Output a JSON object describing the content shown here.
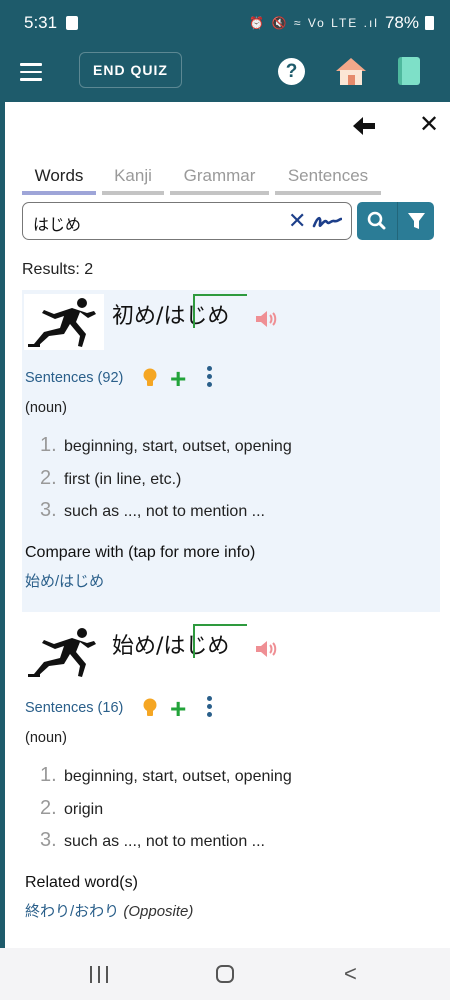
{
  "status": {
    "time": "5:31",
    "icons": "⏰ 🔇 ≈ Vo LTE .ıl",
    "battery": "78%"
  },
  "app_bar": {
    "end_quiz_label": "END QUIZ",
    "help_symbol": "?"
  },
  "header": {
    "close_symbol": "✕"
  },
  "tabs": [
    {
      "label": "Words",
      "active": true
    },
    {
      "label": "Kanji",
      "active": false
    },
    {
      "label": "Grammar",
      "active": false
    },
    {
      "label": "Sentences",
      "active": false
    }
  ],
  "search": {
    "value": "はじめ",
    "clear_symbol": "✕"
  },
  "results_label": "Results: 2",
  "entries": [
    {
      "word": "初め/はじめ",
      "sentences_link": "Sentences (92)",
      "part_of_speech": "(noun)",
      "definitions": [
        {
          "num": "1.",
          "text": "beginning, start, outset, opening"
        },
        {
          "num": "2.",
          "text": "first (in line, etc.)"
        },
        {
          "num": "3.",
          "text": "such as ..., not to mention ..."
        }
      ],
      "related_title": "Compare with (tap for more info)",
      "related_link": "始め/はじめ",
      "related_note": ""
    },
    {
      "word": "始め/はじめ",
      "sentences_link": "Sentences (16)",
      "part_of_speech": "(noun)",
      "definitions": [
        {
          "num": "1.",
          "text": "beginning, start, outset, opening"
        },
        {
          "num": "2.",
          "text": "origin"
        },
        {
          "num": "3.",
          "text": "such as ..., not to mention ..."
        }
      ],
      "related_title": "Related word(s)",
      "related_link": "終わり/おわり",
      "related_note": "(Opposite)"
    }
  ],
  "nav": {
    "back_symbol": "<"
  },
  "colors": {
    "app_bar": "#1e5b6b",
    "accent_button": "#2b7c96",
    "link": "#2a5f8a",
    "pitch_accent": "#2e9a3e",
    "add_plus": "#22a33a",
    "highlight_entry": "#eef4fb"
  }
}
